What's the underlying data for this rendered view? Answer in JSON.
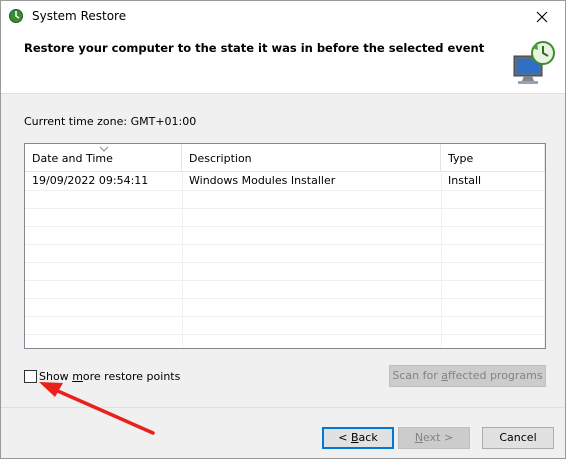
{
  "window": {
    "title": "System Restore"
  },
  "header": {
    "text": "Restore your computer to the state it was in before the selected event"
  },
  "timezone": {
    "label": "Current time zone: GMT+01:00"
  },
  "table": {
    "columns": [
      "Date and Time",
      "Description",
      "Type"
    ],
    "rows": [
      [
        "19/09/2022 09:54:11",
        "Windows Modules Installer",
        "Install"
      ]
    ]
  },
  "options": {
    "show_more_pre": "Show ",
    "show_more_underlined": "m",
    "show_more_post": "ore restore points",
    "show_more_checked": false
  },
  "scan_button": {
    "pre": "Scan for ",
    "underlined": "a",
    "post": "ffected programs"
  },
  "buttons": {
    "back_pre": "< ",
    "back_underlined": "B",
    "back_post": "ack",
    "next_pre": "",
    "next_underlined": "N",
    "next_post": "ext >",
    "cancel": "Cancel"
  },
  "colors": {
    "annotation_arrow": "#e8221b",
    "focus_border": "#0078d7"
  }
}
